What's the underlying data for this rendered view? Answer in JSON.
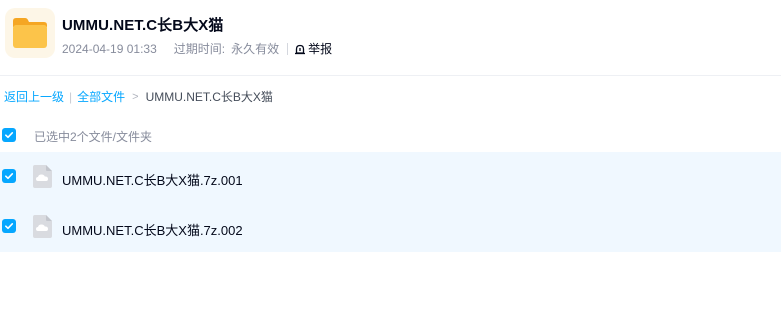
{
  "header": {
    "title": "UMMU.NET.C长B大X猫",
    "date": "2024-04-19 01:33",
    "expire_label": "过期时间:",
    "expire_value": "永久有效",
    "report_label": "举报",
    "folder_icon": "folder-icon"
  },
  "breadcrumb": {
    "back": "返回上一级",
    "all_files": "全部文件",
    "separator": ">",
    "current": "UMMU.NET.C长B大X猫"
  },
  "selection": {
    "text": "已选中2个文件/文件夹",
    "checked": true
  },
  "files": [
    {
      "name": "UMMU.NET.C长B大X猫.7z.001",
      "checked": true,
      "icon": "archive-file-icon"
    },
    {
      "name": "UMMU.NET.C长B大X猫.7z.002",
      "checked": true,
      "icon": "archive-file-icon"
    }
  ],
  "colors": {
    "accent": "#06a7ff",
    "row_selected_bg": "#f0f8ff",
    "folder": "#f9b93b"
  }
}
